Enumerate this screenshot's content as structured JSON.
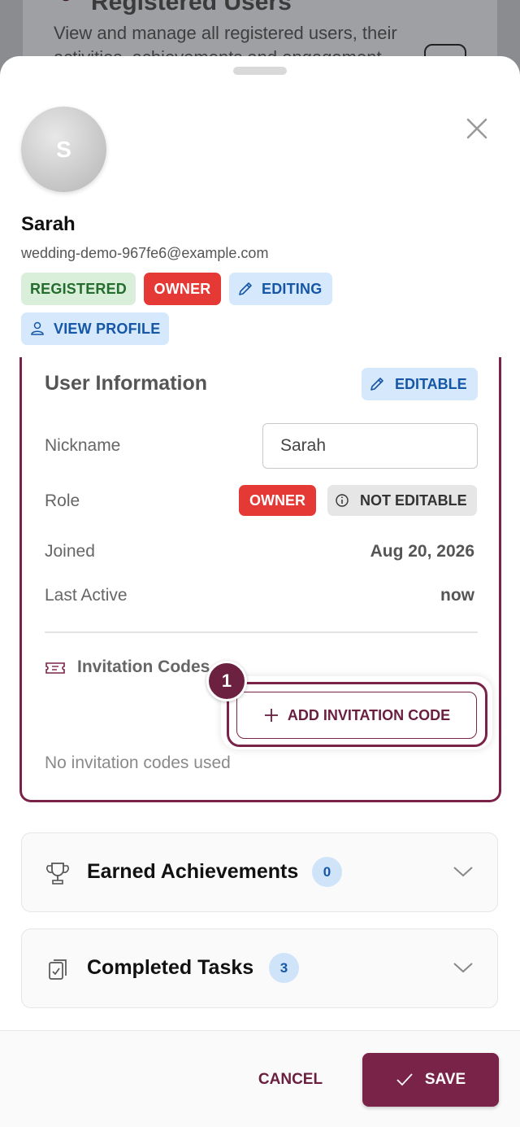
{
  "background": {
    "title": "Registered Users",
    "subtitle": "View and manage all registered users, their activities, achievements and engagement"
  },
  "user": {
    "avatar_initial": "S",
    "name": "Sarah",
    "email": "wedding-demo-967fe6@example.com",
    "chips": {
      "registered": "REGISTERED",
      "owner": "OWNER",
      "editing": "EDITING",
      "view_profile": "VIEW PROFILE"
    }
  },
  "user_info": {
    "title": "User Information",
    "editable_label": "EDITABLE",
    "nickname_label": "Nickname",
    "nickname_value": "Sarah",
    "role_label": "Role",
    "role_value": "OWNER",
    "role_not_editable": "NOT EDITABLE",
    "joined_label": "Joined",
    "joined_value": "Aug 20, 2026",
    "last_active_label": "Last Active",
    "last_active_value": "now",
    "invitation_codes_label": "Invitation Codes",
    "add_invitation_code": "ADD INVITATION CODE",
    "no_codes": "No invitation codes used",
    "step_number": "1"
  },
  "sections": [
    {
      "title": "Earned Achievements",
      "count": "0",
      "icon": "trophy-icon"
    },
    {
      "title": "Completed Tasks",
      "count": "3",
      "icon": "clipboard-check-icon"
    }
  ],
  "footer": {
    "cancel_label": "CANCEL",
    "save_label": "SAVE"
  },
  "colors": {
    "primary": "#7a2348",
    "owner_red": "#e53935",
    "registered_bg": "#d9efda",
    "info_bg": "#d6e8fb"
  }
}
